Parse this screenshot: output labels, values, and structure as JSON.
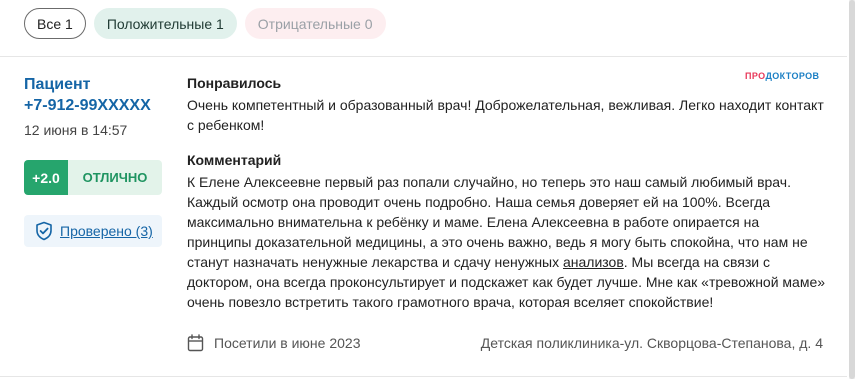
{
  "filters": {
    "all_label": "Все 1",
    "positive_label": "Положительные 1",
    "negative_label": "Отрицательные 0"
  },
  "review": {
    "author_line1": "Пациент",
    "author_line2": "+7-912-99XXXXX",
    "date": "12 июня в 14:57",
    "rating": {
      "score": "+2.0",
      "word": "ОТЛИЧНО",
      "colors": {
        "score_bg": "#26a56d",
        "word_bg": "#e3f3ea",
        "word_text": "#1f9461"
      }
    },
    "verified": {
      "label": "Проверено (3)",
      "icon": "shield-check-icon"
    },
    "brand": {
      "pro": "ПРО",
      "doctor": "ДОКТОРОВ"
    },
    "liked": {
      "title": "Понравилось",
      "text": "Очень компетентный и образованный врач! Доброжелательная, вежливая. Легко находит контакт с ребенком!"
    },
    "comment": {
      "title": "Комментарий",
      "text_before_link": "К Елене Алексеевне первый раз попали случайно, но теперь это наш самый любимый врач. Каждый осмотр она проводит очень подробно. Наша семья доверяет ей на 100%. Всегда максимально внимательна к ребёнку и маме. Елена Алексеевна в работе опирается на принципы доказательной медицины, а это очень важно, ведь я могу быть спокойна, что нам не станут назначать ненужные лекарства и сдачу ненужных ",
      "link_text": "анализов",
      "text_after_link": ". Мы всегда на связи с доктором, она всегда проконсультирует и подскажет как будет лучше. Мне как «тревожной маме» очень повезло встретить такого грамотного врача, которая вселяет спокойствие!"
    },
    "footer": {
      "visit_text": "Посетили в июне 2023",
      "visit_icon": "calendar-icon",
      "clinic": "Детская поликлиника-ул. Скворцова-Степанова, д. 4"
    }
  },
  "colors": {
    "link": "#1565a6",
    "positive_chip_bg": "#e1f1ec",
    "negative_chip_bg": "#fdeef0",
    "brand_pro": "#e8385a",
    "brand_doc": "#1b7fc4"
  }
}
